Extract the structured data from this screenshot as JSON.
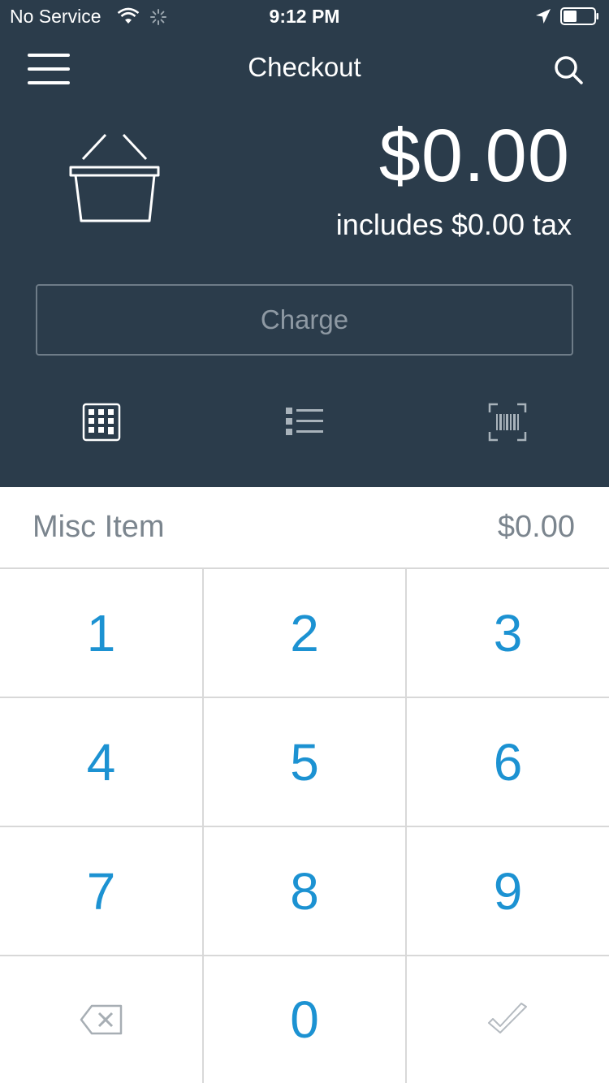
{
  "status_bar": {
    "carrier": "No Service",
    "time": "9:12 PM",
    "wifi_icon": "wifi-icon",
    "activity_icon": "spinner-icon",
    "location_icon": "location-arrow-icon",
    "battery_icon": "battery-icon"
  },
  "nav": {
    "title": "Checkout",
    "menu_icon": "hamburger-menu-icon",
    "search_icon": "search-icon"
  },
  "cart": {
    "basket_icon": "basket-icon",
    "total": "$0.00",
    "tax_text": "includes $0.00 tax"
  },
  "charge": {
    "label": "Charge"
  },
  "tabs": [
    {
      "icon": "keypad-grid-icon",
      "active": true
    },
    {
      "icon": "list-icon",
      "active": false
    },
    {
      "icon": "barcode-scan-icon",
      "active": false
    }
  ],
  "misc_item": {
    "label": "Misc Item",
    "price": "$0.00"
  },
  "keypad": {
    "keys": [
      "1",
      "2",
      "3",
      "4",
      "5",
      "6",
      "7",
      "8",
      "9",
      "0"
    ],
    "backspace_icon": "backspace-icon",
    "confirm_icon": "checkmark-icon"
  },
  "colors": {
    "header_bg": "#2b3c4b",
    "accent": "#1c92d2",
    "muted_text": "#7b858e",
    "divider": "#d8d8d8"
  }
}
